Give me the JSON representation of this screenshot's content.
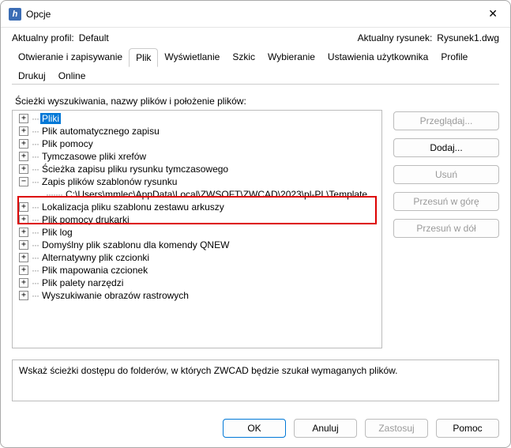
{
  "window": {
    "title": "Opcje"
  },
  "profile": {
    "label": "Aktualny profil:",
    "value": "Default"
  },
  "drawing": {
    "label": "Aktualny rysunek:",
    "value": "Rysunek1.dwg"
  },
  "tabs": {
    "items": [
      "Otwieranie i zapisywanie",
      "Plik",
      "Wyświetlanie",
      "Szkic",
      "Wybieranie",
      "Ustawienia użytkownika",
      "Profile",
      "Drukuj",
      "Online"
    ],
    "activeIndex": 1
  },
  "section": {
    "label": "Ścieżki wyszukiwania, nazwy plików i położenie plików:"
  },
  "tree": {
    "nodes": [
      {
        "label": "Pliki",
        "level": 1,
        "exp": "+",
        "selected": true
      },
      {
        "label": "Plik automatycznego zapisu",
        "level": 1,
        "exp": "+"
      },
      {
        "label": "Plik pomocy",
        "level": 1,
        "exp": "+"
      },
      {
        "label": "Tymczasowe pliki xrefów",
        "level": 1,
        "exp": "+"
      },
      {
        "label": "Ścieżka zapisu pliku rysunku tymczasowego",
        "level": 1,
        "exp": "+"
      },
      {
        "label": "Zapis plików szablonów rysunku",
        "level": 1,
        "exp": "-"
      },
      {
        "label": "C:\\Users\\mmlec\\AppData\\Local\\ZWSOFT\\ZWCAD\\2023\\pl-PL\\Template",
        "level": 2,
        "exp": ""
      },
      {
        "label": "Lokalizacja pliku szablonu zestawu arkuszy",
        "level": 1,
        "exp": "+"
      },
      {
        "label": "Plik pomocy drukarki",
        "level": 1,
        "exp": "+"
      },
      {
        "label": "Plik log",
        "level": 1,
        "exp": "+"
      },
      {
        "label": "Domyślny plik szablonu dla komendy QNEW",
        "level": 1,
        "exp": "+"
      },
      {
        "label": "Alternatywny plik czcionki",
        "level": 1,
        "exp": "+"
      },
      {
        "label": "Plik mapowania czcionek",
        "level": 1,
        "exp": "+"
      },
      {
        "label": "Plik palety narzędzi",
        "level": 1,
        "exp": "+"
      },
      {
        "label": "Wyszukiwanie obrazów rastrowych",
        "level": 1,
        "exp": "+"
      }
    ]
  },
  "sideButtons": {
    "browse": "Przeglądaj...",
    "add": "Dodaj...",
    "remove": "Usuń",
    "moveUp": "Przesuń w górę",
    "moveDown": "Przesuń w dół"
  },
  "help": {
    "text": "Wskaż ścieżki dostępu do folderów, w których ZWCAD będzie szukał wymaganych plików."
  },
  "footer": {
    "ok": "OK",
    "cancel": "Anuluj",
    "apply": "Zastosuj",
    "help": "Pomoc"
  }
}
